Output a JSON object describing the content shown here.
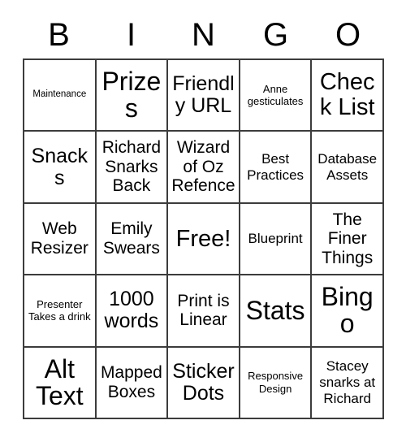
{
  "card": {
    "title": "BINGO Card",
    "header_letters": [
      "B",
      "I",
      "N",
      "G",
      "O"
    ],
    "columns": 5,
    "rows": 5,
    "border_color": "#3c3c3c",
    "text_color": "#000000",
    "background_color": "#ffffff",
    "free_space_label": "Free!",
    "free_space_position": "row3-col3",
    "cells": [
      [
        {
          "text": "Maintenance",
          "size": "xs"
        },
        {
          "text": "Prizes",
          "size": "3xl"
        },
        {
          "text": "Friendly URL",
          "size": "xl"
        },
        {
          "text": "Anne gesticulates",
          "size": "s"
        },
        {
          "text": "Check List",
          "size": "2xl"
        }
      ],
      [
        {
          "text": "Snacks",
          "size": "xl"
        },
        {
          "text": "Richard Snarks Back",
          "size": "l"
        },
        {
          "text": "Wizard of Oz Refence",
          "size": "l"
        },
        {
          "text": "Best Practices",
          "size": "m"
        },
        {
          "text": "Database Assets",
          "size": "m"
        }
      ],
      [
        {
          "text": "Web Resizer",
          "size": "l"
        },
        {
          "text": "Emily Swears",
          "size": "l"
        },
        {
          "text": "Free!",
          "size": "2xl"
        },
        {
          "text": "Blueprint",
          "size": "m"
        },
        {
          "text": "The Finer Things",
          "size": "l"
        }
      ],
      [
        {
          "text": "Presenter Takes a drink",
          "size": "s"
        },
        {
          "text": "1000 words",
          "size": "xl"
        },
        {
          "text": "Print is Linear",
          "size": "l"
        },
        {
          "text": "Stats",
          "size": "3xl"
        },
        {
          "text": "Bingo",
          "size": "3xl"
        }
      ],
      [
        {
          "text": "Alt Text",
          "size": "3xl"
        },
        {
          "text": "Mapped Boxes",
          "size": "l"
        },
        {
          "text": "Sticker Dots",
          "size": "xl"
        },
        {
          "text": "Responsive Design",
          "size": "s"
        },
        {
          "text": "Stacey snarks at Richard",
          "size": "m"
        }
      ]
    ]
  }
}
